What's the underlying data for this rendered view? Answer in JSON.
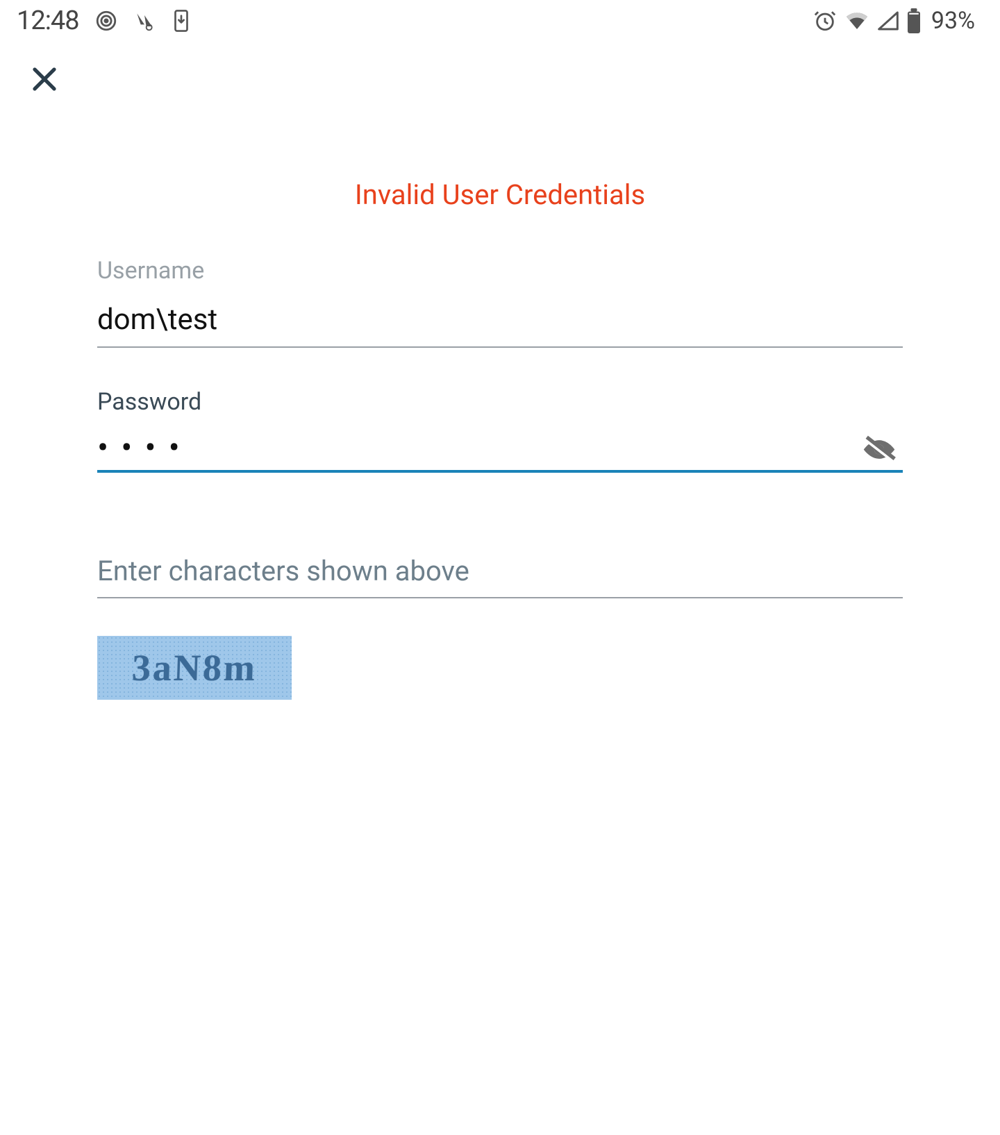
{
  "status_bar": {
    "time": "12:48",
    "battery_pct": "93%"
  },
  "form": {
    "error": "Invalid User Credentials",
    "username_label": "Username",
    "username_value": "dom\\test",
    "password_label": "Password",
    "password_value": "••••",
    "captcha_placeholder": "Enter characters shown above",
    "captcha_value": "",
    "captcha_text": "3aN8m"
  }
}
